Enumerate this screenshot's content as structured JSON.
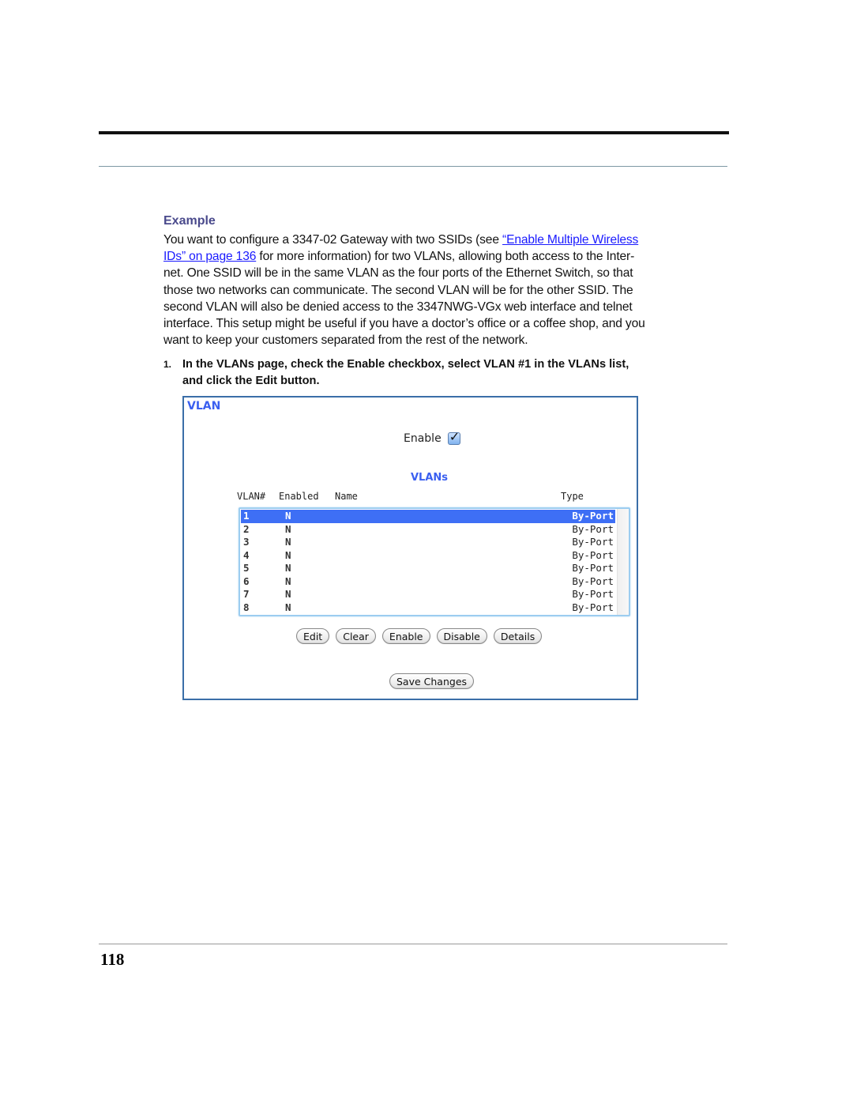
{
  "document": {
    "page_number": "118",
    "example_heading": "Example",
    "paragraph": {
      "line1_pre": "You want to configure a 3347-02 Gateway with two SSIDs (see ",
      "link_part1": "“Enable Multiple Wireless ",
      "link_part2": "IDs” on page 136",
      "line2_post": " for more information) for two VLANs, allowing both access to the Inter-",
      "line3": "net. One SSID will be in the same VLAN as the four ports of the Ethernet Switch, so that",
      "line4": "those two networks can communicate. The second VLAN will be for the other SSID. The",
      "line5": "second VLAN will also be denied access to the 3347NWG-VGx web interface and telnet",
      "line6": "interface. This setup might be useful if you have a doctor’s office or a coffee shop, and you",
      "line7": "want to keep your customers separated from the rest of the network."
    },
    "step": {
      "number": "1.",
      "line1": "In the VLANs page, check the Enable checkbox, select VLAN #1 in the VLANs list,",
      "line2": "and click the Edit button."
    }
  },
  "vlan_panel": {
    "title": "VLAN",
    "enable_label": "Enable",
    "enable_checked": true,
    "checkmark": "✓",
    "list_title": "VLANs",
    "columns": {
      "vlan_num": "VLAN#",
      "enabled": "Enabled",
      "name": "Name",
      "type": "Type"
    },
    "rows": [
      {
        "vlan": "1",
        "enabled": "N",
        "name": "",
        "type": "By-Port",
        "selected": true
      },
      {
        "vlan": "2",
        "enabled": "N",
        "name": "",
        "type": "By-Port"
      },
      {
        "vlan": "3",
        "enabled": "N",
        "name": "",
        "type": "By-Port"
      },
      {
        "vlan": "4",
        "enabled": "N",
        "name": "",
        "type": "By-Port"
      },
      {
        "vlan": "5",
        "enabled": "N",
        "name": "",
        "type": "By-Port"
      },
      {
        "vlan": "6",
        "enabled": "N",
        "name": "",
        "type": "By-Port"
      },
      {
        "vlan": "7",
        "enabled": "N",
        "name": "",
        "type": "By-Port"
      },
      {
        "vlan": "8",
        "enabled": "N",
        "name": "",
        "type": "By-Port"
      }
    ],
    "buttons": {
      "edit": "Edit",
      "clear": "Clear",
      "enable": "Enable",
      "disable": "Disable",
      "details": "Details",
      "save": "Save Changes"
    },
    "colors": {
      "accent": "#3a5ff0",
      "selection": "#3e6ff5",
      "panel_border": "#3a6ea8",
      "link": "#1a1aff",
      "heading": "#4a4a8c"
    }
  }
}
